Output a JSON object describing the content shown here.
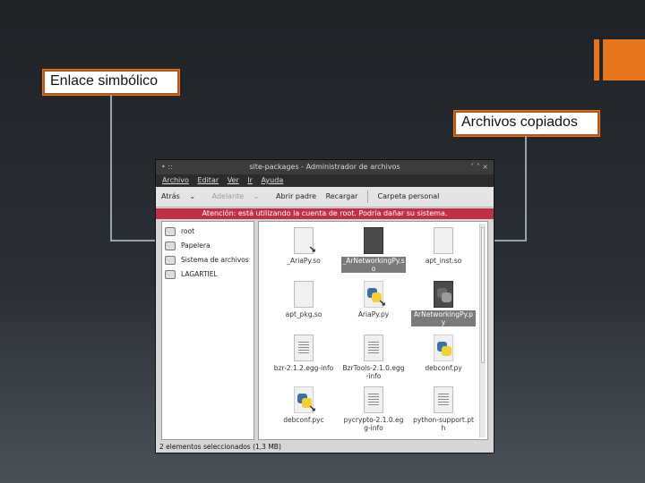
{
  "callouts": {
    "left": "Enlace simbólico",
    "right": "Archivos copiados"
  },
  "window": {
    "title": "site-packages - Administrador de archivos",
    "titlebar_left": "• ::",
    "titlebar_right": "˅ ˄ ×",
    "menu": [
      "Archivo",
      "Editar",
      "Ver",
      "Ir",
      "Ayuda"
    ],
    "toolbar": {
      "back": "Atrás",
      "forward": "Adelante",
      "up": "Abrir padre",
      "reload": "Recargar",
      "personal": "Carpeta personal"
    },
    "warning": "Atención: está utilizando la cuenta de root. Podría dañar su sistema.",
    "sidebar": [
      {
        "label": "root",
        "icon": "home-folder-icon"
      },
      {
        "label": "Papelera",
        "icon": "trash-icon"
      },
      {
        "label": "Sistema de archivos",
        "icon": "drive-icon"
      },
      {
        "label": "LAGARTIEL",
        "icon": "disk-icon"
      }
    ],
    "files": [
      {
        "name": "_AriaPy.so",
        "kind": "doc-link",
        "selected": false
      },
      {
        "name": "_ArNetworkingPy.so",
        "kind": "doc-dark",
        "selected": true
      },
      {
        "name": "apt_inst.so",
        "kind": "doc",
        "selected": false
      },
      {
        "name": "apt_pkg.so",
        "kind": "doc",
        "selected": false
      },
      {
        "name": "AriaPy.py",
        "kind": "py-link",
        "selected": false
      },
      {
        "name": "ArNetworkingPy.py",
        "kind": "py-dark",
        "selected": true
      },
      {
        "name": "bzr-2.1.2.egg-info",
        "kind": "text-link",
        "selected": false
      },
      {
        "name": "BzrTools-2.1.0.egg-info",
        "kind": "text-link",
        "selected": false
      },
      {
        "name": "debconf.py",
        "kind": "py",
        "selected": false
      },
      {
        "name": "debconf.pyc",
        "kind": "py-link",
        "selected": false
      },
      {
        "name": "pycrypto-2.1.0.egg-info",
        "kind": "text-link",
        "selected": false
      },
      {
        "name": "python-support.pth",
        "kind": "text-link",
        "selected": false
      }
    ],
    "status": "2 elementos seleccionados (1,3 MB)"
  },
  "colors": {
    "accent": "#e8761c",
    "warning": "#c0304a",
    "callout_border": "#b2571d"
  }
}
